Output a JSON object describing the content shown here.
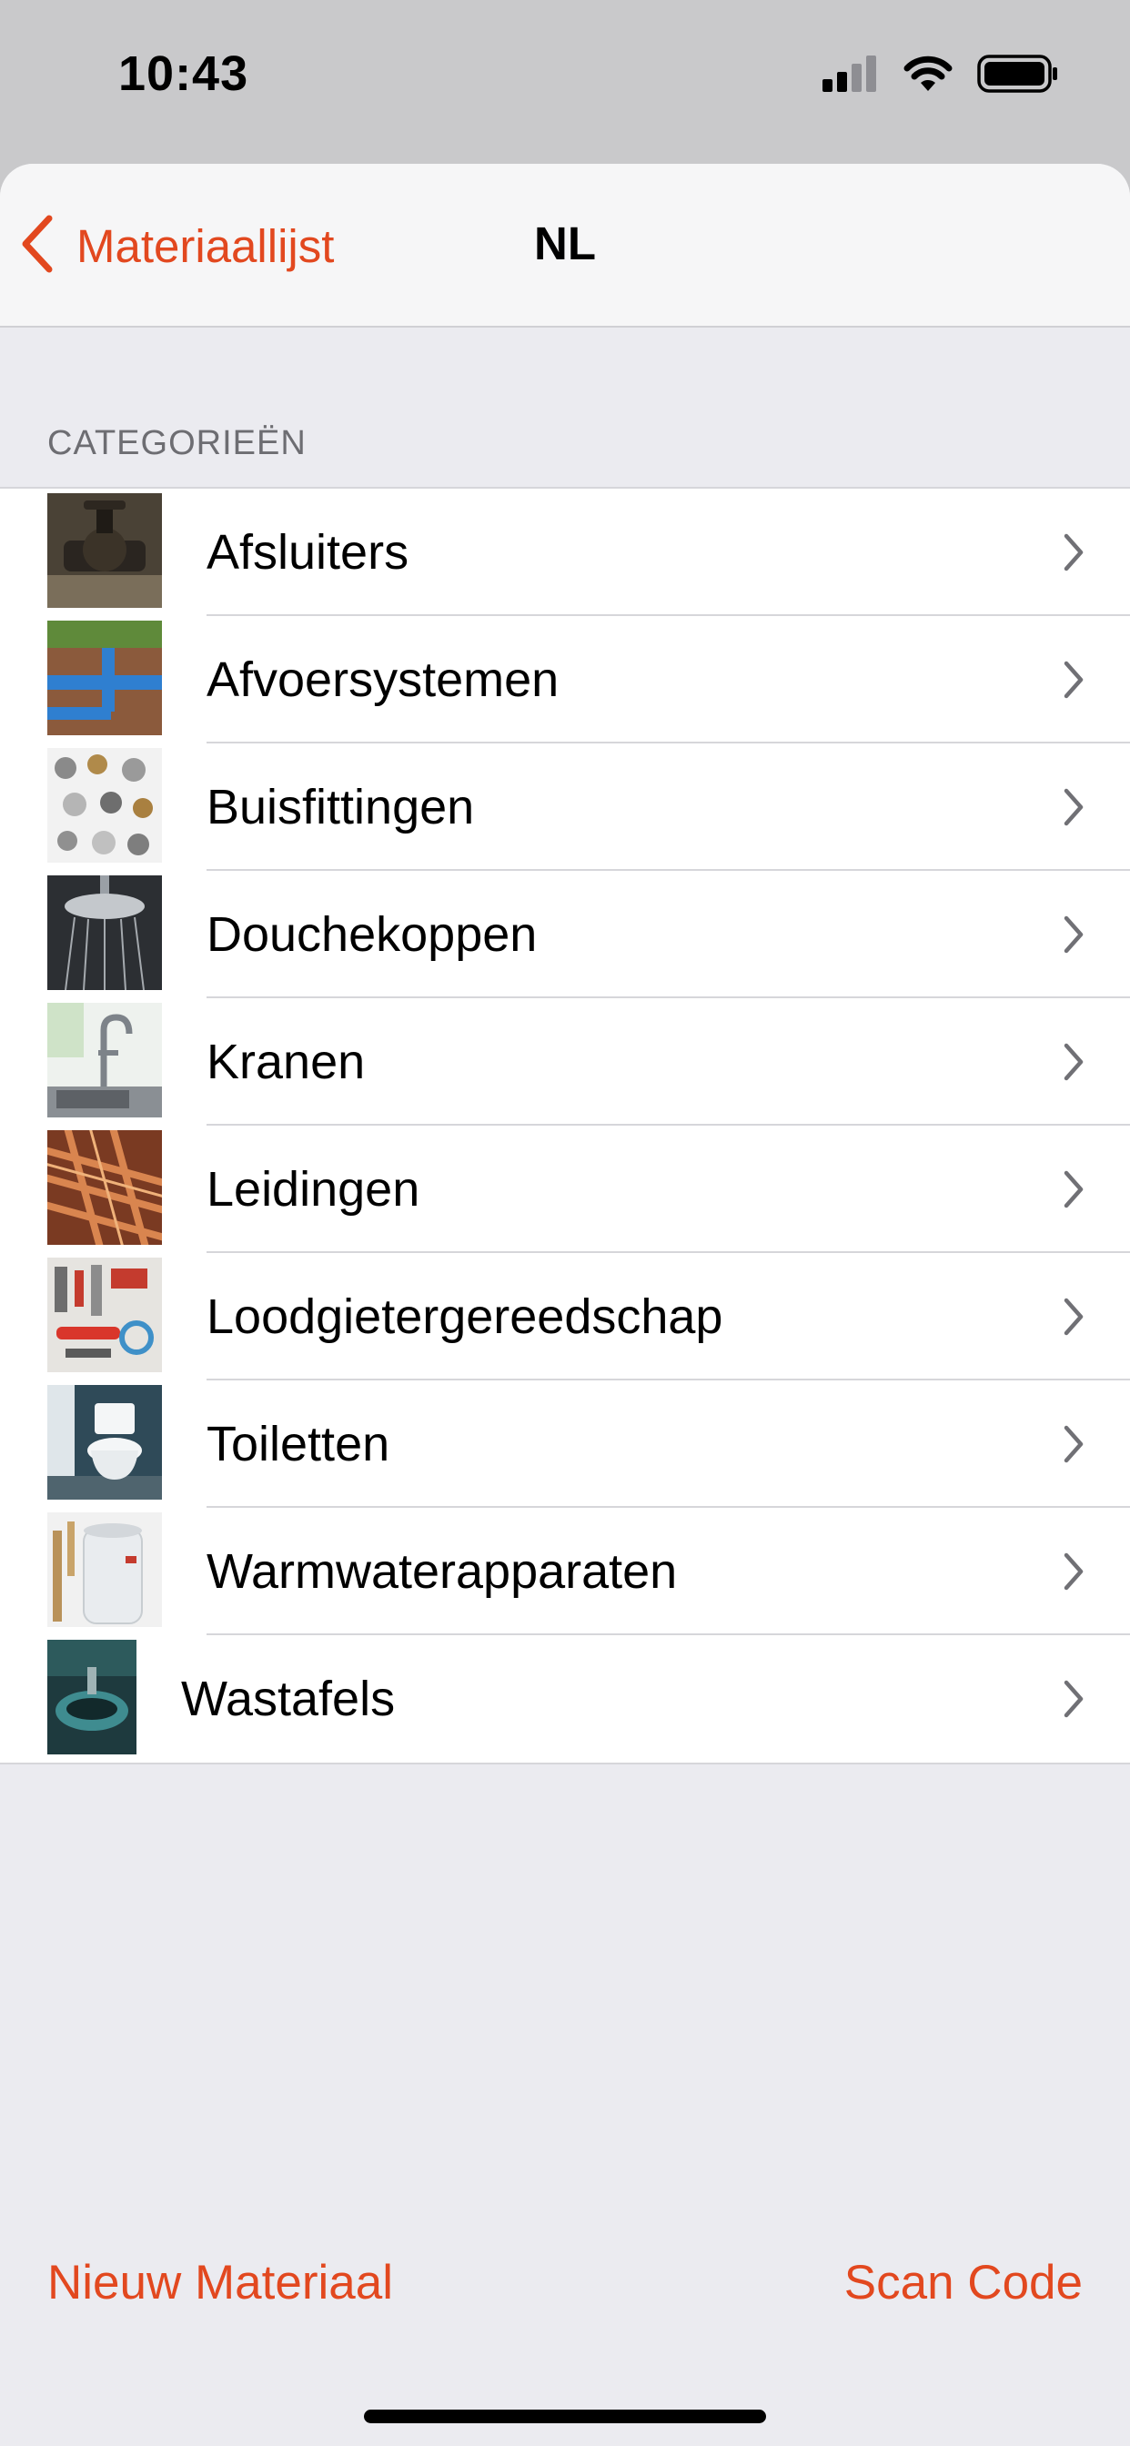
{
  "status": {
    "time": "10:43"
  },
  "nav": {
    "back_label": "Materiaallijst",
    "title": "NL"
  },
  "section": {
    "header": "CATEGORIEËN"
  },
  "categories": [
    {
      "label": "Afsluiters"
    },
    {
      "label": "Afvoersystemen"
    },
    {
      "label": "Buisfittingen"
    },
    {
      "label": "Douchekoppen"
    },
    {
      "label": "Kranen"
    },
    {
      "label": "Leidingen"
    },
    {
      "label": "Loodgietergereedschap"
    },
    {
      "label": "Toiletten"
    },
    {
      "label": "Warmwaterapparaten"
    },
    {
      "label": "Wastafels"
    }
  ],
  "toolbar": {
    "new_label": "Nieuw Materiaal",
    "scan_label": "Scan Code"
  },
  "colors": {
    "accent": "#e2481f",
    "background": "#ebebf0",
    "cell": "#ffffff"
  }
}
